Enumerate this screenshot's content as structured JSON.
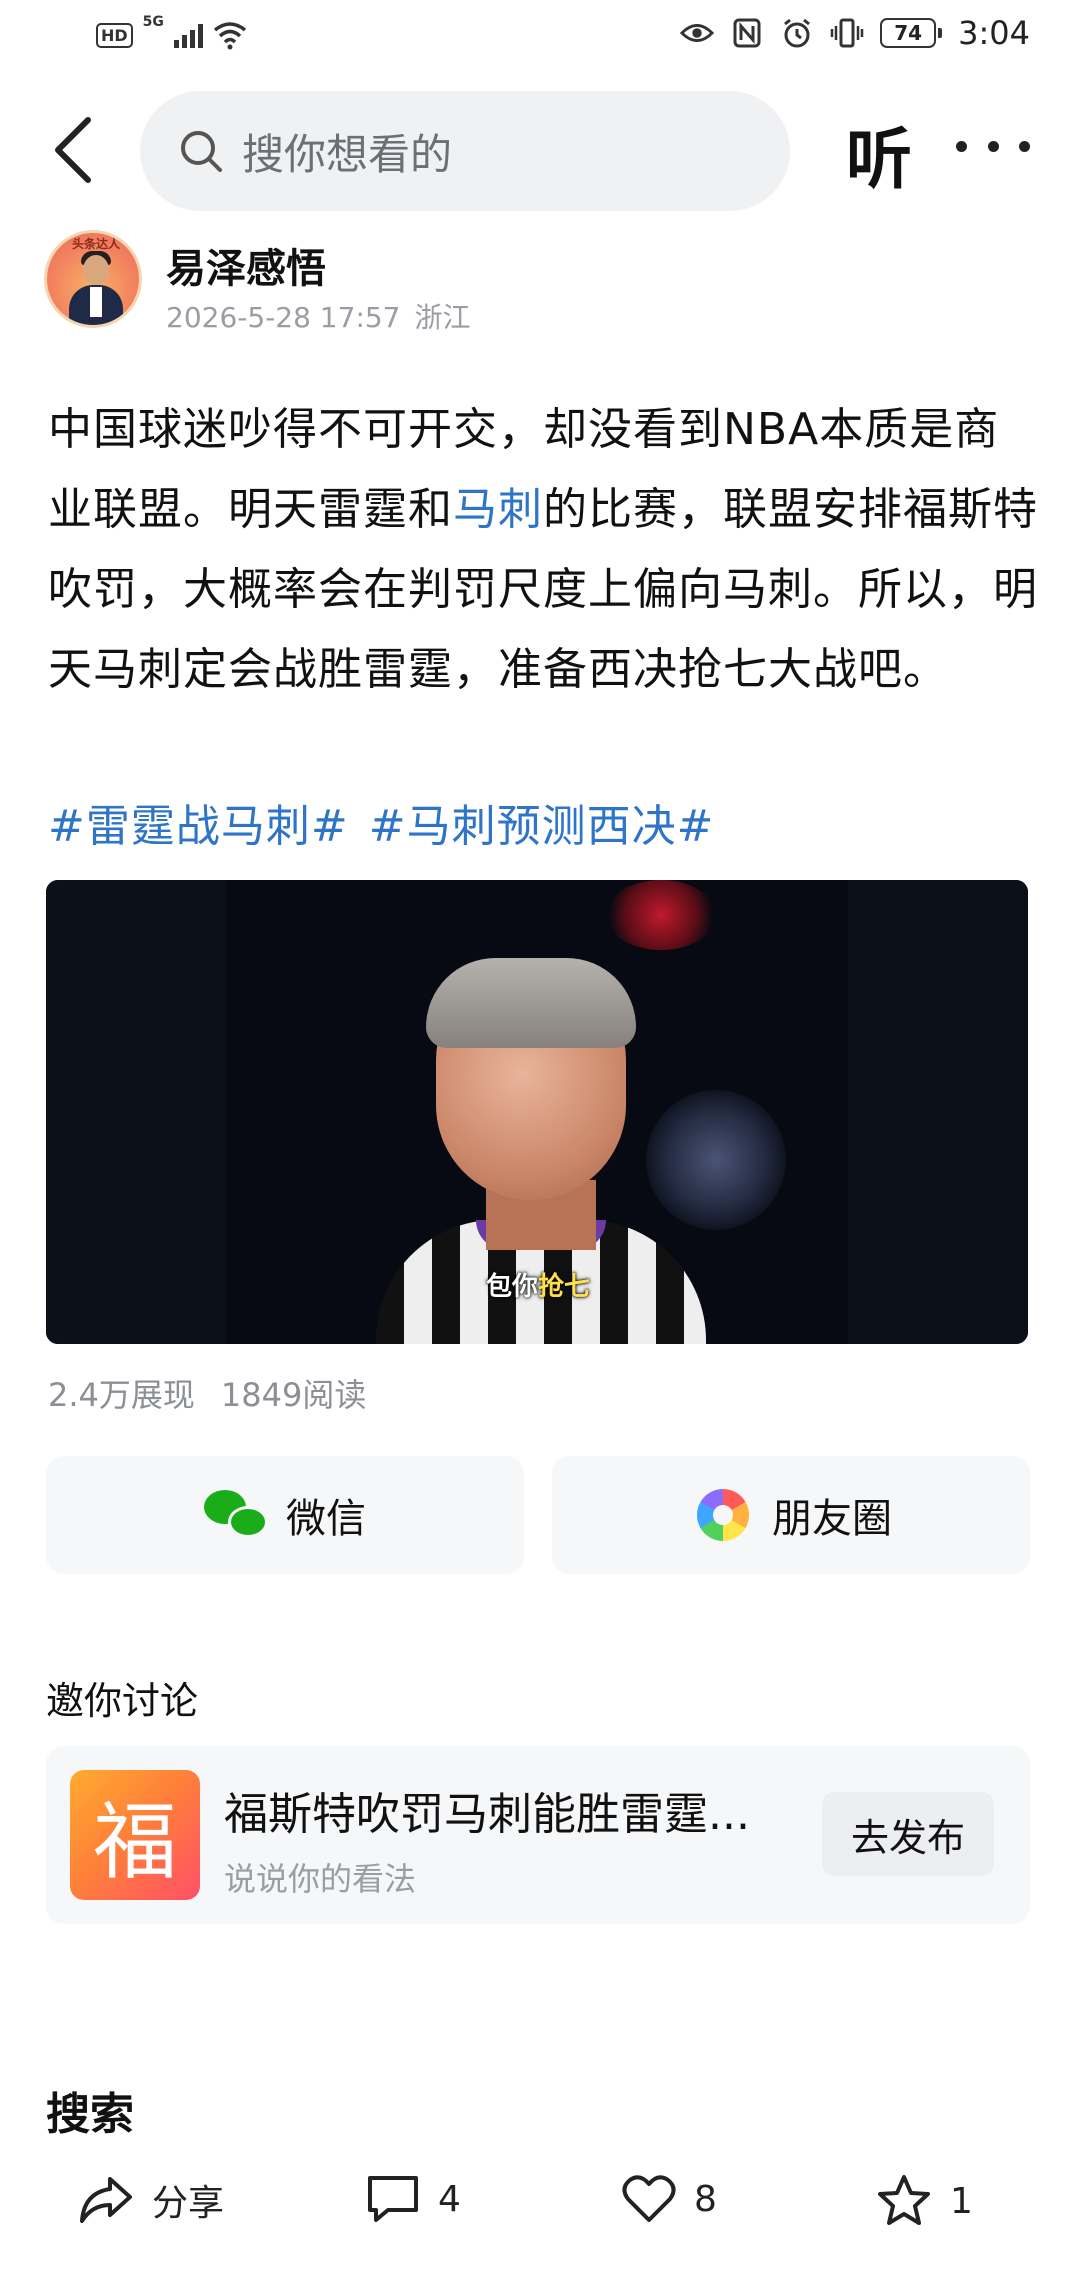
{
  "status_bar": {
    "hd": "HD",
    "network": "5G",
    "battery": "74",
    "time": "3:04"
  },
  "top_bar": {
    "search_placeholder": "搜你想看的",
    "listen_label": "听"
  },
  "author": {
    "name": "易泽感悟",
    "date": "2026-5-28 17:57",
    "location": "浙江",
    "avatar_banner": "头条达人"
  },
  "post": {
    "text_before": "中国球迷吵得不可开交，却没看到NBA本质是商业联盟。明天雷霆和",
    "link_text": "马刺",
    "text_after": "的比赛，联盟安排福斯特吹罚，大概率会在判罚尺度上偏向马刺。所以，明天马刺定会战胜雷霆，准备西决抢七大战吧。",
    "tags": [
      "#雷霆战马刺#",
      "#马刺预测西决#"
    ]
  },
  "video": {
    "caption_prefix": "包你",
    "caption_highlight": "抢七"
  },
  "stats": {
    "impressions": "2.4万展现",
    "reads": "1849阅读"
  },
  "share": {
    "wechat_label": "微信",
    "moments_label": "朋友圈"
  },
  "discussion": {
    "title": "邀你讨论",
    "badge_char": "福",
    "topic": "福斯特吹罚马刺能胜雷霆...",
    "subtitle": "说说你的看法",
    "publish_label": "去发布"
  },
  "search_section": {
    "title": "搜索"
  },
  "bottom_bar": {
    "share_label": "分享",
    "comment_count": "4",
    "like_count": "8",
    "favorite_count": "1"
  }
}
